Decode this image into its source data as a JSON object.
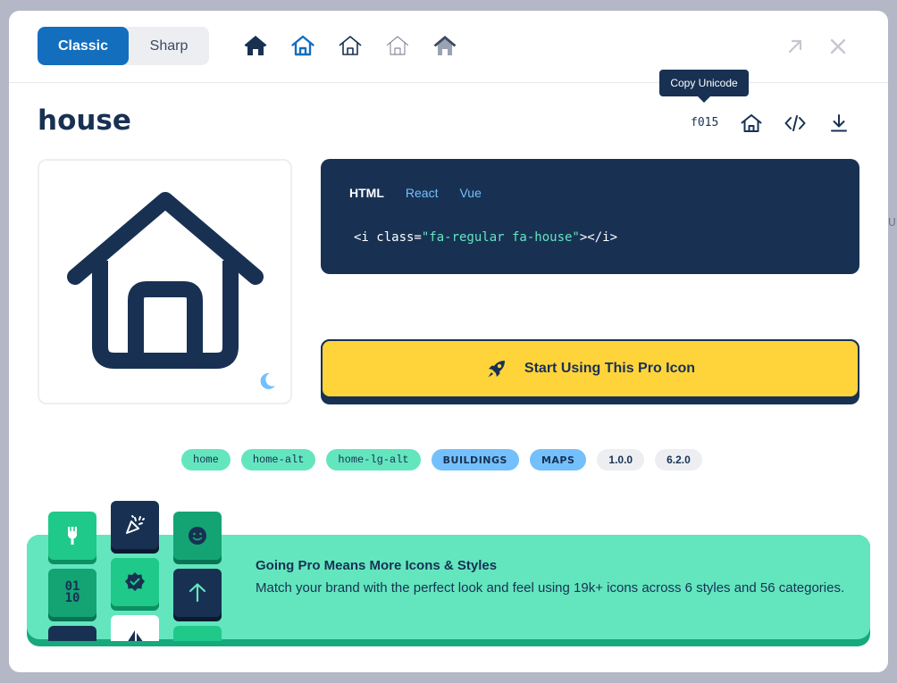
{
  "style_toggle": {
    "classic_label": "Classic",
    "sharp_label": "Sharp"
  },
  "variants": [
    {
      "name": "solid",
      "icon": "house-solid-icon"
    },
    {
      "name": "regular",
      "icon": "house-regular-icon"
    },
    {
      "name": "light",
      "icon": "house-light-icon"
    },
    {
      "name": "thin",
      "icon": "house-thin-icon"
    },
    {
      "name": "duotone",
      "icon": "house-duotone-icon"
    }
  ],
  "header_actions": {
    "open_icon": "arrow-up-right-icon",
    "close_icon": "close-icon"
  },
  "icon": {
    "name": "house",
    "unicode": "f015"
  },
  "tooltip": "Copy Unicode",
  "code": {
    "tabs": [
      "HTML",
      "React",
      "Vue"
    ],
    "active_tab": "HTML",
    "open": "<i class=",
    "class_string": "\"fa-regular fa-house\"",
    "close": "></i>"
  },
  "cta_label": "Start Using This Pro Icon",
  "tags": [
    {
      "label": "home",
      "kind": "alias"
    },
    {
      "label": "home-alt",
      "kind": "alias"
    },
    {
      "label": "home-lg-alt",
      "kind": "alias"
    },
    {
      "label": "BUILDINGS",
      "kind": "category"
    },
    {
      "label": "MAPS",
      "kind": "category"
    },
    {
      "label": "1.0.0",
      "kind": "version"
    },
    {
      "label": "6.2.0",
      "kind": "version"
    }
  ],
  "promo": {
    "title": "Going Pro Means More Icons & Styles",
    "text": "Match your brand with the perfect look and feel using 19k+ icons across 6 styles and 56 categories."
  },
  "colors": {
    "navy": "#183153",
    "blue": "#146ebe",
    "yellow": "#ffd43b",
    "mint": "#63e6be",
    "sky": "#74c0fc"
  }
}
